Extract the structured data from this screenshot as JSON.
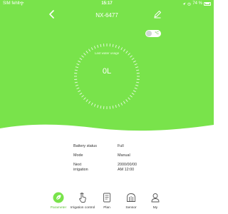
{
  "status_bar": {
    "carrier": "SIM fehlt",
    "time": "15:17",
    "battery": "74 %"
  },
  "header": {
    "title": "NX-6477"
  },
  "unit_toggle": {
    "unit": "°C",
    "on": false
  },
  "gauge": {
    "label": "Last water usage",
    "value": "0L"
  },
  "info": {
    "battery_status_label": "Battery status",
    "battery_status_value": "Full",
    "mode_label": "Mode",
    "mode_value": "Manual",
    "next_irrigation_label_line1": "Next",
    "next_irrigation_label_line2": "irrigation",
    "next_irrigation_value_line1": "2000/00/00",
    "next_irrigation_value_line2": "AM 12:00"
  },
  "tabs": [
    {
      "label": "Parameter",
      "icon": "leaf-icon",
      "active": true
    },
    {
      "label": "Irrigation control",
      "icon": "hand-tap-icon",
      "active": false
    },
    {
      "label": "Plan",
      "icon": "plan-document-icon",
      "active": false
    },
    {
      "label": "Sensor",
      "icon": "sensor-icon",
      "active": false
    },
    {
      "label": "My",
      "icon": "user-icon",
      "active": false
    }
  ],
  "colors": {
    "accent_green": "#79e34b",
    "active_tab": "#5fbf3a"
  }
}
